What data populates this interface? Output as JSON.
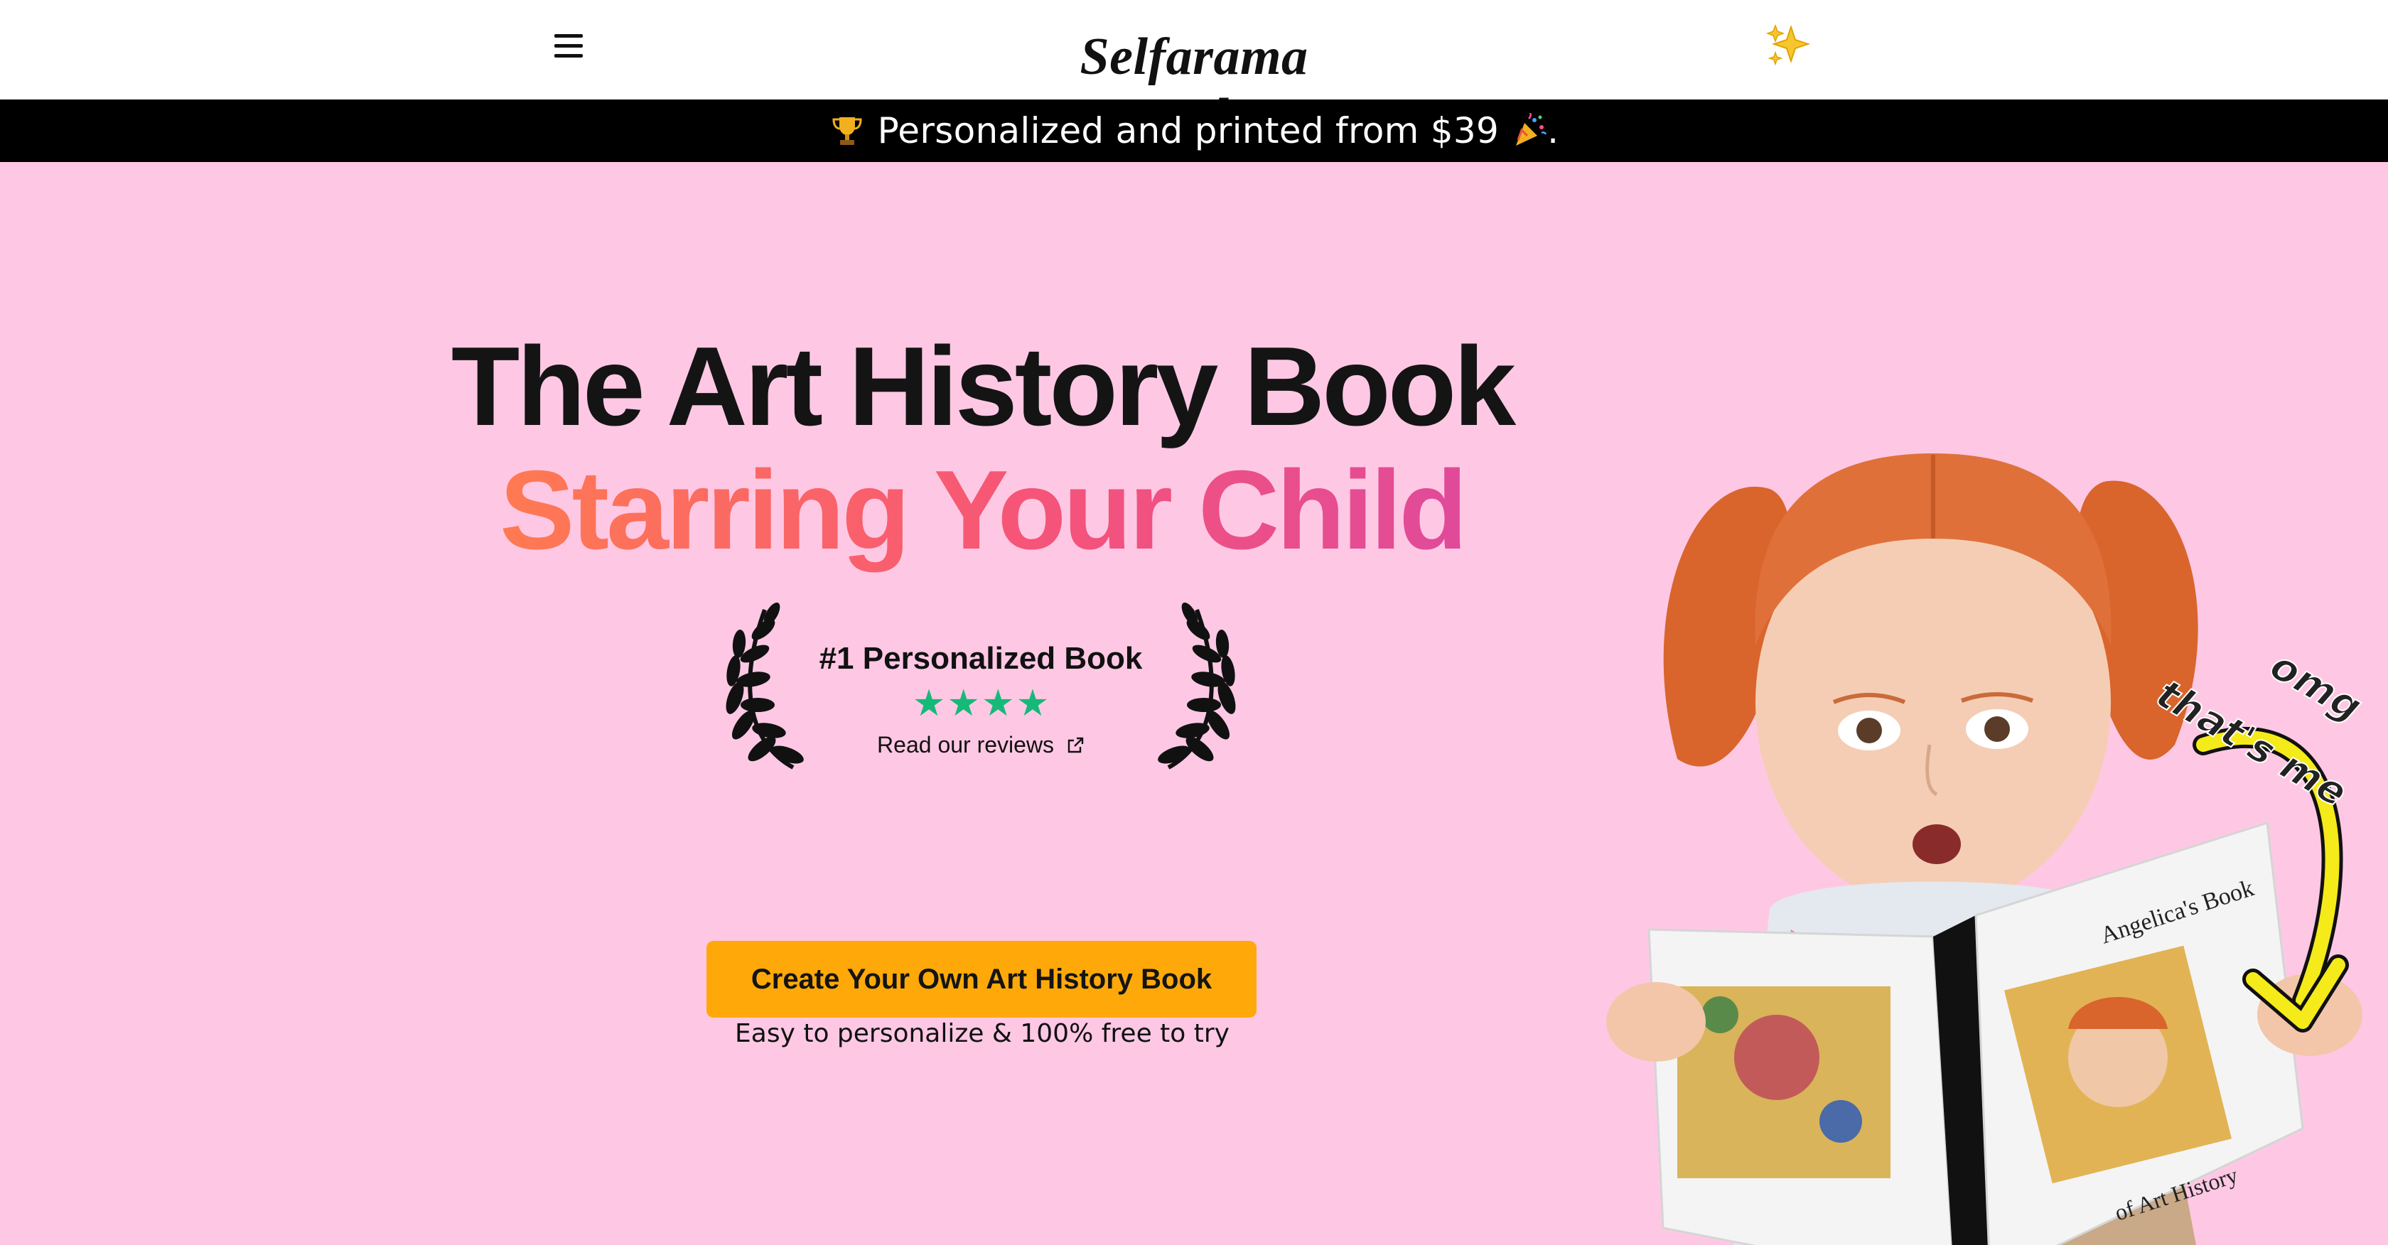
{
  "header": {
    "brand": "Selfarama Books",
    "menu_icon": "hamburger-menu-icon",
    "sparkle_icon": "sparkles-icon"
  },
  "banner": {
    "text": "Personalized and printed from $39",
    "suffix": ".",
    "leading_icon": "trophy-icon",
    "trailing_icon": "party-popper-icon"
  },
  "hero": {
    "title_line1": "The Art History Book",
    "title_line2": "Starring Your Child",
    "award_title": "#1 Personalized Book",
    "rating_stars": 4,
    "reviews_link": "Read our reviews",
    "cta_label": "Create Your Own Art History Book",
    "cta_subtext": "Easy to personalize & 100% free to try"
  },
  "illustration": {
    "sticker_line1": "omg",
    "sticker_line2": "that's me",
    "book_title_top": "Angelica's Book",
    "book_title_bottom": "of Art History"
  },
  "colors": {
    "hero_bg": "#fec8e4",
    "cta_bg": "#fea909",
    "stars": "#17b978",
    "gradient_start": "#ff7a52",
    "gradient_end": "#e04a9a",
    "banner_bg": "#000000"
  }
}
